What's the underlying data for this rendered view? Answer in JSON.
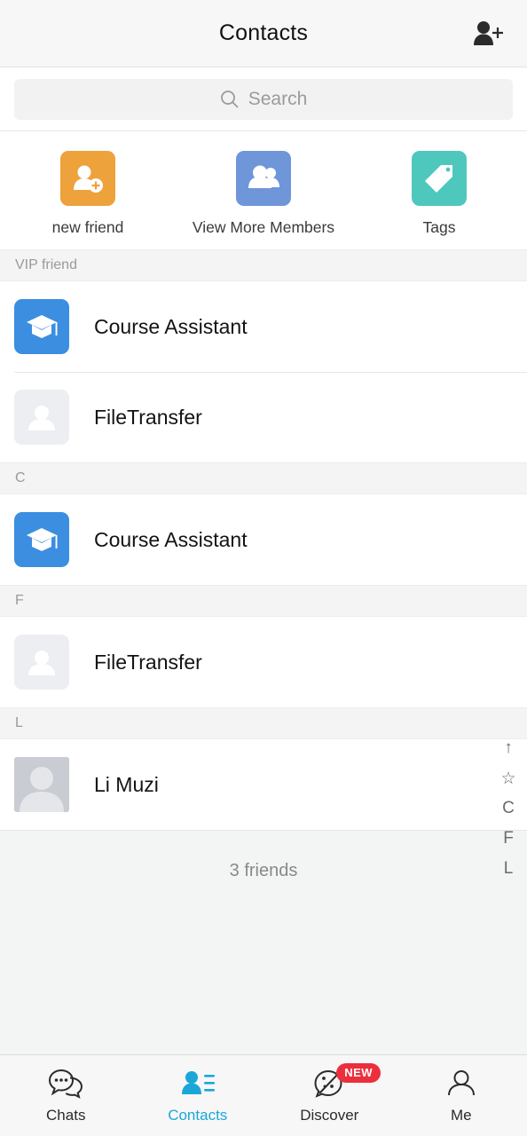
{
  "header": {
    "title": "Contacts",
    "add_friend_icon": "person-add-icon"
  },
  "search": {
    "placeholder": "Search",
    "icon": "search-icon"
  },
  "quick_actions": [
    {
      "label": "new friend",
      "icon": "person-add-icon",
      "color": "#eda23b"
    },
    {
      "label": "View More Members",
      "icon": "group-icon",
      "color": "#6f96d8"
    },
    {
      "label": "Tags",
      "icon": "tag-icon",
      "color": "#4ec8bd"
    }
  ],
  "sections": [
    {
      "header": "VIP friend",
      "contacts": [
        {
          "name": "Course Assistant",
          "avatar": "graduation-cap-icon",
          "avatar_type": "blue"
        },
        {
          "name": "FileTransfer",
          "avatar": "person-icon",
          "avatar_type": "placeholder"
        }
      ]
    },
    {
      "header": "C",
      "contacts": [
        {
          "name": "Course Assistant",
          "avatar": "graduation-cap-icon",
          "avatar_type": "blue"
        }
      ]
    },
    {
      "header": "F",
      "contacts": [
        {
          "name": "FileTransfer",
          "avatar": "person-icon",
          "avatar_type": "placeholder"
        }
      ]
    },
    {
      "header": "L",
      "contacts": [
        {
          "name": "Li Muzi",
          "avatar": "person-portrait-icon",
          "avatar_type": "portrait"
        }
      ]
    }
  ],
  "friends_count": "3 friends",
  "index_rail": [
    "↑",
    "☆",
    "C",
    "F",
    "L"
  ],
  "tabs": [
    {
      "label": "Chats",
      "icon": "chat-bubbles-icon",
      "active": false,
      "badge": ""
    },
    {
      "label": "Contacts",
      "icon": "contacts-icon",
      "active": true,
      "badge": ""
    },
    {
      "label": "Discover",
      "icon": "compass-icon",
      "active": false,
      "badge": "NEW"
    },
    {
      "label": "Me",
      "icon": "person-outline-icon",
      "active": false,
      "badge": ""
    }
  ],
  "colors": {
    "accent": "#1aa7d8",
    "badge": "#ec2f3c",
    "avatar_blue": "#3b8ee0",
    "background": "#f3f4f4"
  }
}
